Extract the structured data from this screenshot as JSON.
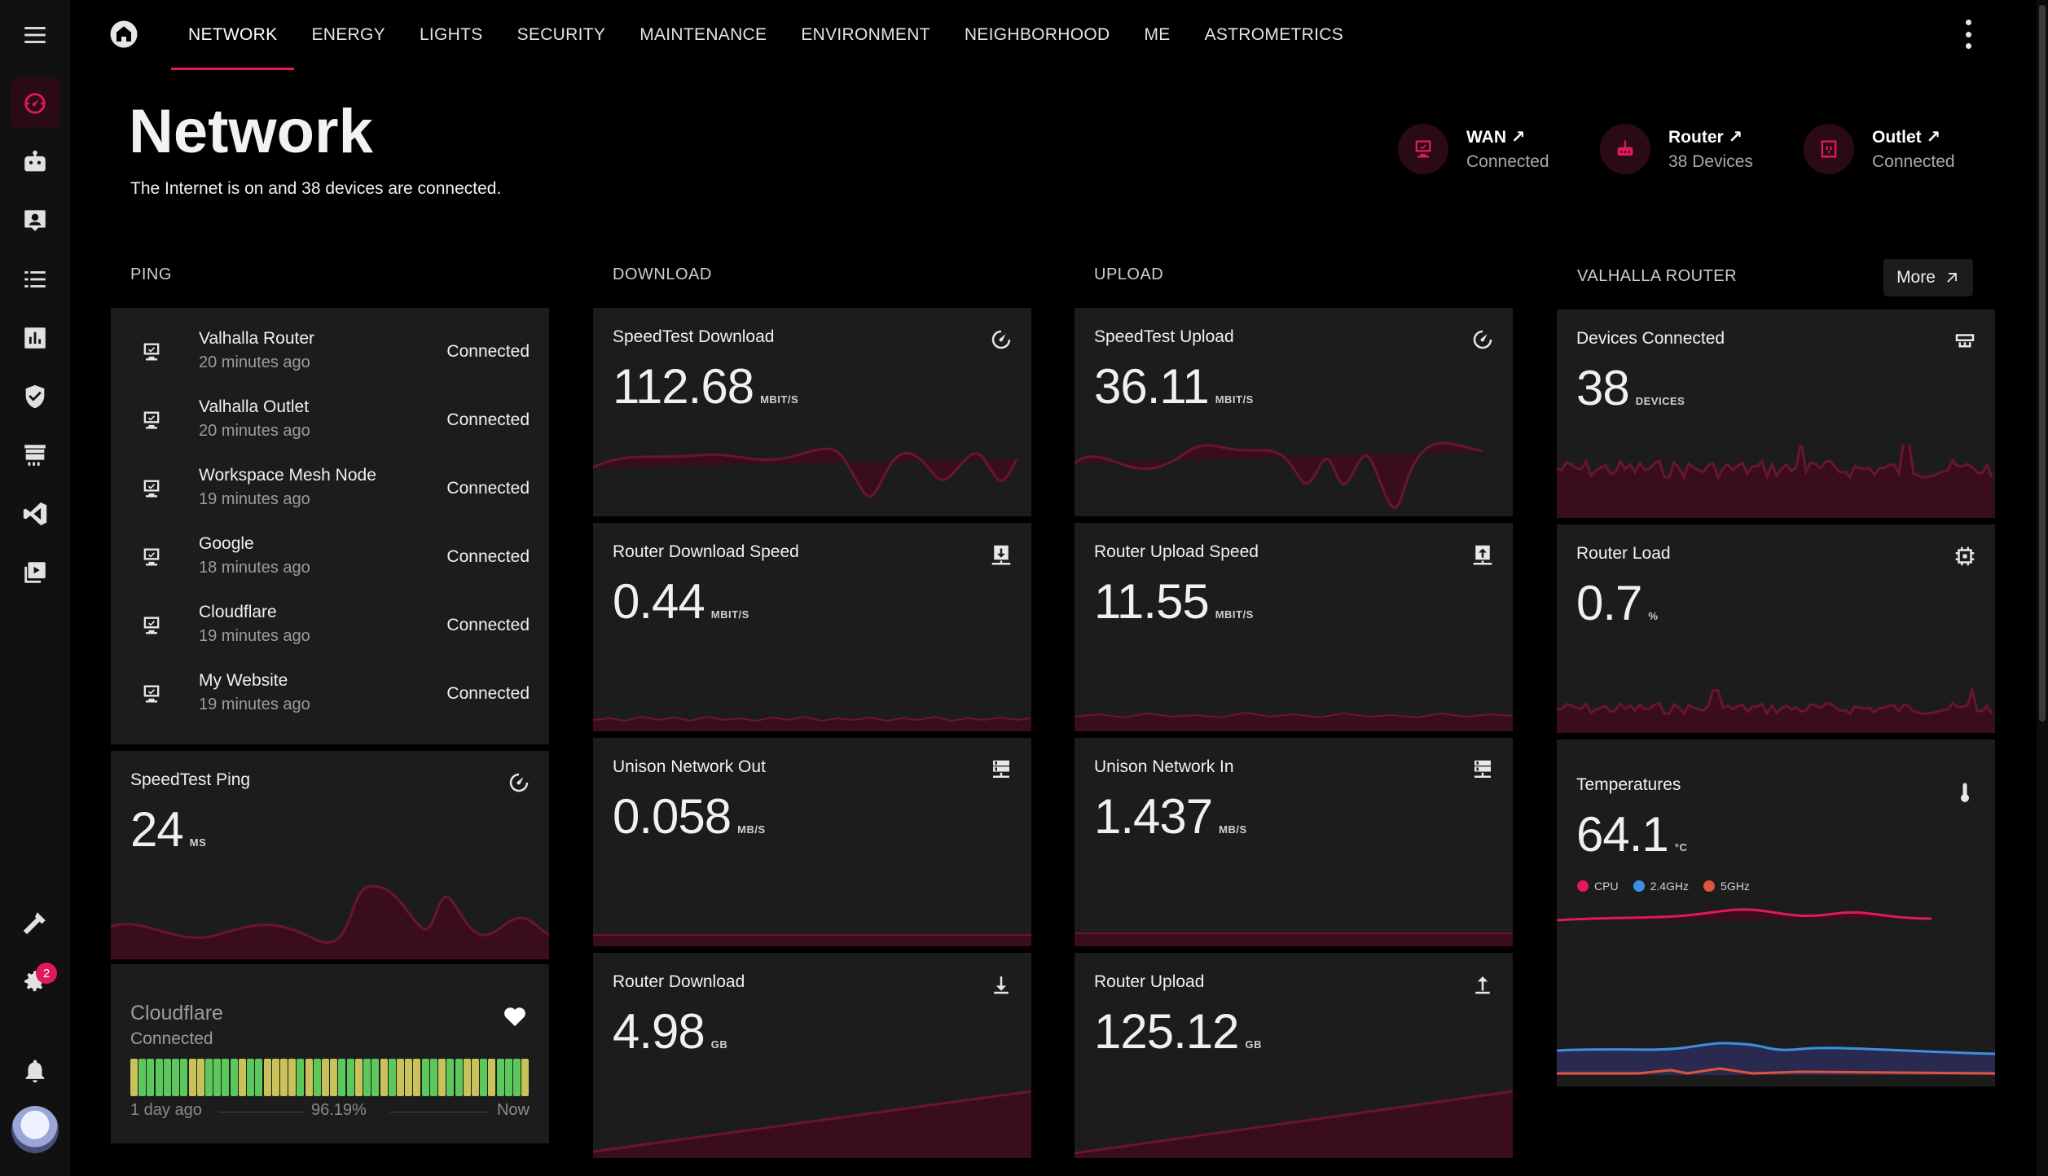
{
  "nav": {
    "tabs": [
      "NETWORK",
      "ENERGY",
      "LIGHTS",
      "SECURITY",
      "MAINTENANCE",
      "ENVIRONMENT",
      "NEIGHBORHOOD",
      "ME",
      "ASTROMETRICS"
    ],
    "active": "NETWORK"
  },
  "sidebar": {
    "settings_badge": "2"
  },
  "page": {
    "title": "Network",
    "subtitle": "The Internet is on and 38 devices are connected."
  },
  "chips": {
    "wan": {
      "label": "WAN ↗",
      "status": "Connected"
    },
    "router": {
      "label": "Router ↗",
      "status": "38 Devices"
    },
    "outlet": {
      "label": "Outlet ↗",
      "status": "Connected"
    }
  },
  "columns": {
    "ping": "PING",
    "download": "DOWNLOAD",
    "upload": "UPLOAD",
    "router": "VALHALLA ROUTER",
    "more": "More"
  },
  "ping_list": [
    {
      "name": "Valhalla Router",
      "time": "20 minutes ago",
      "status": "Connected"
    },
    {
      "name": "Valhalla Outlet",
      "time": "20 minutes ago",
      "status": "Connected"
    },
    {
      "name": "Workspace Mesh Node",
      "time": "19 minutes ago",
      "status": "Connected"
    },
    {
      "name": "Google",
      "time": "18 minutes ago",
      "status": "Connected"
    },
    {
      "name": "Cloudflare",
      "time": "19 minutes ago",
      "status": "Connected"
    },
    {
      "name": "My Website",
      "time": "19 minutes ago",
      "status": "Connected"
    }
  ],
  "cards": {
    "speedtest_ping": {
      "name": "SpeedTest Ping",
      "value": "24",
      "unit": "MS"
    },
    "speedtest_download": {
      "name": "SpeedTest Download",
      "value": "112.68",
      "unit": "MBIT/S"
    },
    "router_download_speed": {
      "name": "Router Download Speed",
      "value": "0.44",
      "unit": "MBIT/S"
    },
    "unison_out": {
      "name": "Unison Network Out",
      "value": "0.058",
      "unit": "MB/S"
    },
    "router_download": {
      "name": "Router Download",
      "value": "4.98",
      "unit": "GB"
    },
    "speedtest_upload": {
      "name": "SpeedTest Upload",
      "value": "36.11",
      "unit": "MBIT/S"
    },
    "router_upload_speed": {
      "name": "Router Upload Speed",
      "value": "11.55",
      "unit": "MBIT/S"
    },
    "unison_in": {
      "name": "Unison Network In",
      "value": "1.437",
      "unit": "MB/S"
    },
    "router_upload": {
      "name": "Router Upload",
      "value": "125.12",
      "unit": "GB"
    },
    "devices_connected": {
      "name": "Devices Connected",
      "value": "38",
      "unit": "DEVICES"
    },
    "router_load": {
      "name": "Router Load",
      "value": "0.7",
      "unit": "%"
    },
    "temperatures": {
      "name": "Temperatures",
      "value": "64.1",
      "unit": "°C"
    }
  },
  "temperature_legend": [
    {
      "label": "CPU",
      "color": "#e0195c"
    },
    {
      "label": "2.4GHz",
      "color": "#3d8fe0"
    },
    {
      "label": "5GHz",
      "color": "#e0533d"
    }
  ],
  "uptime": {
    "title": "Cloudflare",
    "status": "Connected",
    "start": "1 day ago",
    "percent": "96.19%",
    "end": "Now",
    "bars": [
      "y",
      "g",
      "g",
      "g",
      "g",
      "g",
      "g",
      "y",
      "y",
      "g",
      "g",
      "g",
      "g",
      "y",
      "g",
      "g",
      "y",
      "y",
      "y",
      "y",
      "g",
      "y",
      "g",
      "y",
      "y",
      "g",
      "g",
      "y",
      "g",
      "g",
      "y",
      "g",
      "y",
      "y",
      "y",
      "g",
      "g",
      "y",
      "g",
      "g",
      "y",
      "y",
      "g",
      "y",
      "g",
      "g",
      "g",
      "y"
    ]
  },
  "colors": {
    "accent": "#e0195c",
    "card": "#1c1c1c",
    "good": "#5cc85c",
    "warn": "#c9c25a"
  }
}
